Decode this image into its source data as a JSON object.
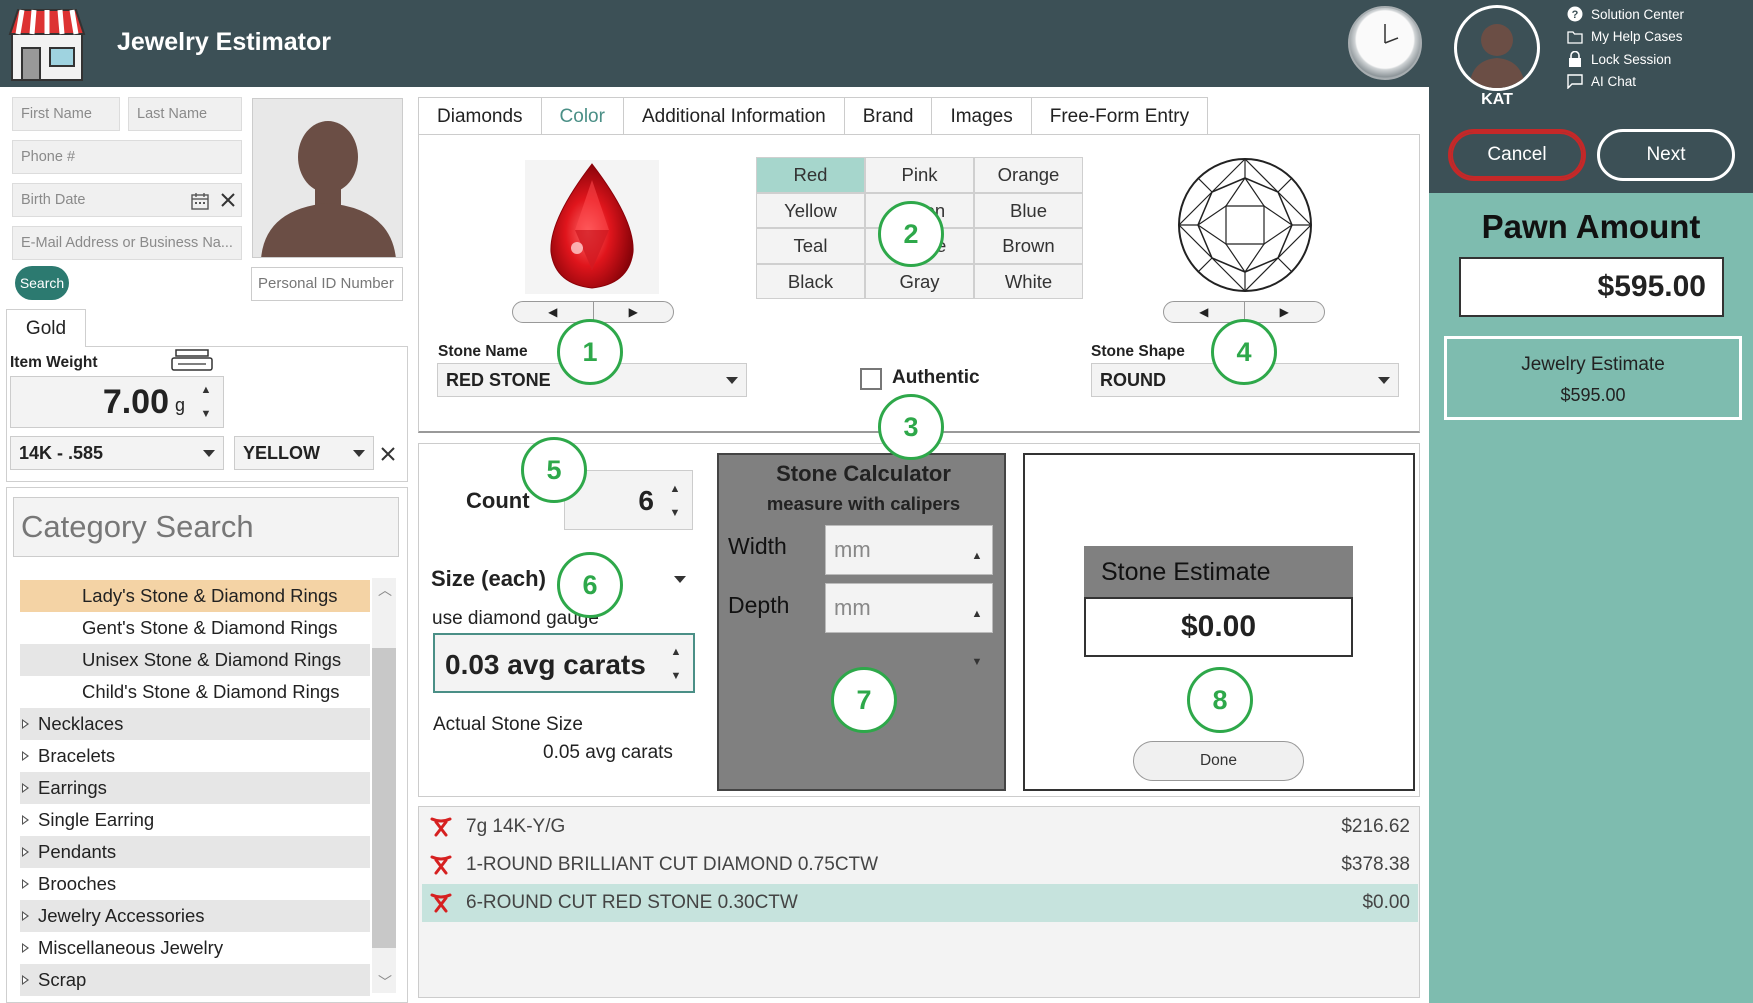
{
  "app": {
    "title": "Jewelry Estimator"
  },
  "user": {
    "name": "KAT"
  },
  "help_links": [
    "Solution Center",
    "My Help Cases",
    "Lock Session",
    "AI Chat"
  ],
  "actions": {
    "cancel": "Cancel",
    "next": "Next"
  },
  "pawn": {
    "label": "Pawn Amount",
    "amount": "$595.00",
    "estimate_label": "Jewelry Estimate",
    "estimate_value": "$595.00"
  },
  "customer": {
    "first_name_placeholder": "First Name",
    "last_name_placeholder": "Last Name",
    "phone_placeholder": "Phone #",
    "birth_date_placeholder": "Birth Date",
    "email_placeholder": "E-Mail Address or Business Na...",
    "search_label": "Search",
    "personal_id_placeholder": "Personal ID Number"
  },
  "gold": {
    "tab": "Gold",
    "item_weight_label": "Item Weight",
    "weight": "7.00",
    "unit": "g",
    "karat": "14K - .585",
    "color": "YELLOW"
  },
  "category": {
    "search_placeholder": "Category Search",
    "items": [
      {
        "label": "Lady's Stone & Diamond Rings",
        "level": "sub",
        "selected": true
      },
      {
        "label": "Gent's Stone & Diamond Rings",
        "level": "sub"
      },
      {
        "label": "Unisex Stone & Diamond Rings",
        "level": "sub"
      },
      {
        "label": "Child's Stone & Diamond Rings",
        "level": "sub"
      },
      {
        "label": "Necklaces",
        "level": "top"
      },
      {
        "label": "Bracelets",
        "level": "top"
      },
      {
        "label": "Earrings",
        "level": "top"
      },
      {
        "label": "Single Earring",
        "level": "top"
      },
      {
        "label": "Pendants",
        "level": "top"
      },
      {
        "label": "Brooches",
        "level": "top"
      },
      {
        "label": "Jewelry Accessories",
        "level": "top"
      },
      {
        "label": "Miscellaneous Jewelry",
        "level": "top"
      },
      {
        "label": "Scrap",
        "level": "top"
      }
    ]
  },
  "tabs": [
    "Diamonds",
    "Color",
    "Additional Information",
    "Brand",
    "Images",
    "Free-Form Entry"
  ],
  "active_tab": "Color",
  "colors": [
    "Red",
    "Pink",
    "Orange",
    "Yellow",
    "Green",
    "Blue",
    "Teal",
    "Purple",
    "Brown",
    "Black",
    "Gray",
    "White"
  ],
  "selected_color": "Red",
  "stone": {
    "name_label": "Stone Name",
    "name": "RED STONE",
    "authentic_label": "Authentic",
    "shape_label": "Stone Shape",
    "shape": "ROUND"
  },
  "count": {
    "label": "Count",
    "value": "6"
  },
  "size": {
    "label": "Size (each)",
    "gauge_label": "use diamond gauge",
    "value": "0.03 avg carats",
    "actual_label": "Actual Stone Size",
    "actual_value": "0.05 avg carats"
  },
  "calculator": {
    "title": "Stone Calculator",
    "subtitle": "measure with calipers",
    "width_label": "Width",
    "depth_label": "Depth",
    "placeholder": "mm"
  },
  "stone_estimate": {
    "label": "Stone Estimate",
    "value": "$0.00",
    "done": "Done"
  },
  "line_items": [
    {
      "text": "7g 14K-Y/G",
      "price": "$216.62"
    },
    {
      "text": "1-ROUND BRILLIANT CUT DIAMOND 0.75CTW",
      "price": "$378.38"
    },
    {
      "text": "6-ROUND CUT RED STONE 0.30CTW",
      "price": "$0.00",
      "selected": true
    }
  ],
  "callouts": [
    "1",
    "2",
    "3",
    "4",
    "5",
    "6",
    "7",
    "8"
  ],
  "theme": {
    "header": "#3c5056",
    "side": "#7ebcaf",
    "accent": "#4a8f86",
    "callout": "#2ea84a"
  }
}
